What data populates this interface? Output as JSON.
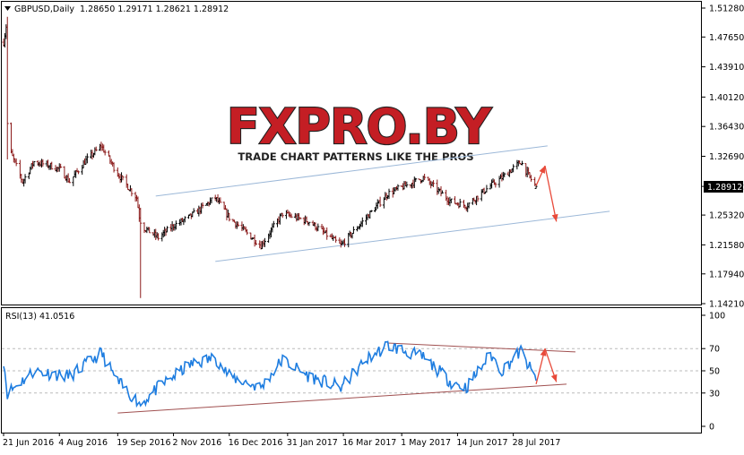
{
  "header": {
    "symbol_line": "GBPUSD,Daily  1.28650 1.29171 1.28621 1.28912"
  },
  "watermark": {
    "brand": "FXPRO.BY",
    "tagline": "TRADE CHART PATTERNS LIKE THE PROS"
  },
  "price_axis": {
    "ticks": [
      "1.51280",
      "1.47650",
      "1.43910",
      "1.40120",
      "1.36430",
      "1.32690",
      "1.28912",
      "1.25320",
      "1.21580",
      "1.17940",
      "1.14210"
    ],
    "tick_values": [
      1.5128,
      1.4765,
      1.4391,
      1.4012,
      1.3643,
      1.3269,
      1.28912,
      1.2532,
      1.2158,
      1.1794,
      1.1421
    ],
    "current": "1.28912",
    "range": [
      1.1421,
      1.5128
    ]
  },
  "rsi": {
    "label": "RSI(13) 41.0516",
    "ticks": [
      "100",
      "70",
      "50",
      "30",
      "0"
    ],
    "tick_values": [
      100,
      70,
      50,
      30,
      0
    ],
    "levels": [
      70,
      50,
      30
    ]
  },
  "time_axis": {
    "labels": [
      "21 Jun 2016",
      "4 Aug 2016",
      "19 Sep 2016",
      "2 Nov 2016",
      "16 Dec 2016",
      "31 Jan 2017",
      "16 Mar 2017",
      "1 May 2017",
      "14 Jun 2017",
      "28 Jul 2017"
    ]
  },
  "colors": {
    "bullish": "#000000",
    "bearish": "#8b1a1a",
    "rsi_line": "#1e7de0",
    "price_channel": "#9cb8d8",
    "rsi_channel": "#a05050",
    "arrow": "#e84a3a"
  },
  "chart_data": {
    "type": "ohlc",
    "series_name": "GBPUSD",
    "timeframe": "Daily",
    "last_bar": {
      "open": 1.2865,
      "high": 1.29171,
      "low": 1.28621,
      "close": 1.28912
    },
    "close_path": [
      {
        "date": "2016-06-21",
        "close": 1.47
      },
      {
        "date": "2016-06-23",
        "close": 1.49
      },
      {
        "date": "2016-06-24",
        "close": 1.37
      },
      {
        "date": "2016-06-27",
        "close": 1.33
      },
      {
        "date": "2016-07-06",
        "close": 1.295
      },
      {
        "date": "2016-07-15",
        "close": 1.32
      },
      {
        "date": "2016-07-28",
        "close": 1.315
      },
      {
        "date": "2016-08-05",
        "close": 1.31
      },
      {
        "date": "2016-08-12",
        "close": 1.295
      },
      {
        "date": "2016-08-24",
        "close": 1.32
      },
      {
        "date": "2016-09-06",
        "close": 1.34
      },
      {
        "date": "2016-09-19",
        "close": 1.305
      },
      {
        "date": "2016-10-04",
        "close": 1.275
      },
      {
        "date": "2016-10-07",
        "close": 1.24
      },
      {
        "date": "2016-10-21",
        "close": 1.225
      },
      {
        "date": "2016-11-02",
        "close": 1.24
      },
      {
        "date": "2016-11-14",
        "close": 1.25
      },
      {
        "date": "2016-12-05",
        "close": 1.275
      },
      {
        "date": "2016-12-16",
        "close": 1.25
      },
      {
        "date": "2017-01-10",
        "close": 1.215
      },
      {
        "date": "2017-01-27",
        "close": 1.255
      },
      {
        "date": "2017-02-17",
        "close": 1.245
      },
      {
        "date": "2017-03-14",
        "close": 1.215
      },
      {
        "date": "2017-04-03",
        "close": 1.25
      },
      {
        "date": "2017-04-20",
        "close": 1.28
      },
      {
        "date": "2017-05-18",
        "close": 1.3
      },
      {
        "date": "2017-06-09",
        "close": 1.27
      },
      {
        "date": "2017-06-21",
        "close": 1.265
      },
      {
        "date": "2017-07-10",
        "close": 1.29
      },
      {
        "date": "2017-07-19",
        "close": 1.3
      },
      {
        "date": "2017-08-03",
        "close": 1.32
      },
      {
        "date": "2017-08-10",
        "close": 1.3
      },
      {
        "date": "2017-08-15",
        "close": 1.2891
      }
    ],
    "rsi_path": [
      {
        "date": "2016-06-21",
        "value": 60
      },
      {
        "date": "2016-06-24",
        "value": 30
      },
      {
        "date": "2016-07-15",
        "value": 50
      },
      {
        "date": "2016-08-12",
        "value": 45
      },
      {
        "date": "2016-09-06",
        "value": 66
      },
      {
        "date": "2016-09-19",
        "value": 40
      },
      {
        "date": "2016-10-07",
        "value": 20
      },
      {
        "date": "2016-10-21",
        "value": 35
      },
      {
        "date": "2016-11-14",
        "value": 55
      },
      {
        "date": "2016-12-05",
        "value": 62
      },
      {
        "date": "2016-12-16",
        "value": 45
      },
      {
        "date": "2017-01-10",
        "value": 35
      },
      {
        "date": "2017-01-27",
        "value": 60
      },
      {
        "date": "2017-02-17",
        "value": 45
      },
      {
        "date": "2017-03-14",
        "value": 35
      },
      {
        "date": "2017-04-03",
        "value": 60
      },
      {
        "date": "2017-04-20",
        "value": 73
      },
      {
        "date": "2017-05-18",
        "value": 62
      },
      {
        "date": "2017-06-09",
        "value": 40
      },
      {
        "date": "2017-06-21",
        "value": 35
      },
      {
        "date": "2017-07-10",
        "value": 65
      },
      {
        "date": "2017-07-19",
        "value": 50
      },
      {
        "date": "2017-08-03",
        "value": 68
      },
      {
        "date": "2017-08-15",
        "value": 41.05
      }
    ],
    "price_channel": {
      "upper": [
        {
          "date": "2016-10-19",
          "price": 1.277
        },
        {
          "date": "2017-08-24",
          "price": 1.34
        }
      ],
      "lower": [
        {
          "date": "2016-12-05",
          "price": 1.195
        },
        {
          "date": "2017-10-12",
          "price": 1.258
        }
      ]
    },
    "rsi_channel": {
      "upper": [
        {
          "date": "2017-04-20",
          "value": 75
        },
        {
          "date": "2017-09-15",
          "value": 67
        }
      ],
      "lower": [
        {
          "date": "2016-09-19",
          "value": 12
        },
        {
          "date": "2017-09-08",
          "value": 38
        }
      ]
    },
    "forecast_arrows": [
      {
        "pane": "price",
        "from": {
          "date": "2017-08-15",
          "price": 1.29
        },
        "to": {
          "date": "2017-08-22",
          "price": 1.315
        }
      },
      {
        "pane": "price",
        "from": {
          "date": "2017-08-22",
          "price": 1.315
        },
        "to": {
          "date": "2017-08-31",
          "price": 1.245
        }
      },
      {
        "pane": "rsi",
        "from": {
          "date": "2017-08-15",
          "value": 38
        },
        "to": {
          "date": "2017-08-22",
          "value": 70
        }
      },
      {
        "pane": "rsi",
        "from": {
          "date": "2017-08-22",
          "value": 70
        },
        "to": {
          "date": "2017-08-31",
          "value": 40
        }
      }
    ]
  }
}
